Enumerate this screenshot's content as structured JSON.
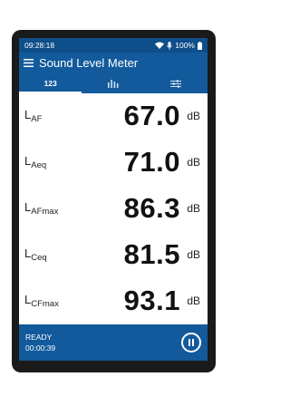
{
  "status_bar": {
    "time": "09:28:18",
    "battery": "100%",
    "icons": [
      "wifi-icon",
      "mic-icon",
      "battery-icon"
    ]
  },
  "app_bar": {
    "title": "Sound Level Meter",
    "menu_icon": "menu-icon"
  },
  "tabs": [
    {
      "label": "123",
      "active": true
    },
    {
      "icon": "bars-icon",
      "active": false
    },
    {
      "icon": "sliders-icon",
      "active": false
    }
  ],
  "readings": [
    {
      "symbol": "L",
      "subscript": "AF",
      "value": "67.0",
      "unit": "dB"
    },
    {
      "symbol": "L",
      "subscript": "Aeq",
      "value": "71.0",
      "unit": "dB"
    },
    {
      "symbol": "L",
      "subscript": "AFmax",
      "value": "86.3",
      "unit": "dB"
    },
    {
      "symbol": "L",
      "subscript": "Ceq",
      "value": "81.5",
      "unit": "dB"
    },
    {
      "symbol": "L",
      "subscript": "CFmax",
      "value": "93.1",
      "unit": "dB"
    }
  ],
  "bottom_bar": {
    "state": "READY",
    "elapsed": "00:00:39",
    "action_icon": "pause-icon"
  },
  "colors": {
    "primary": "#125a9c",
    "status_bar": "#0e4e8a",
    "device_frame": "#1a1a1a"
  }
}
